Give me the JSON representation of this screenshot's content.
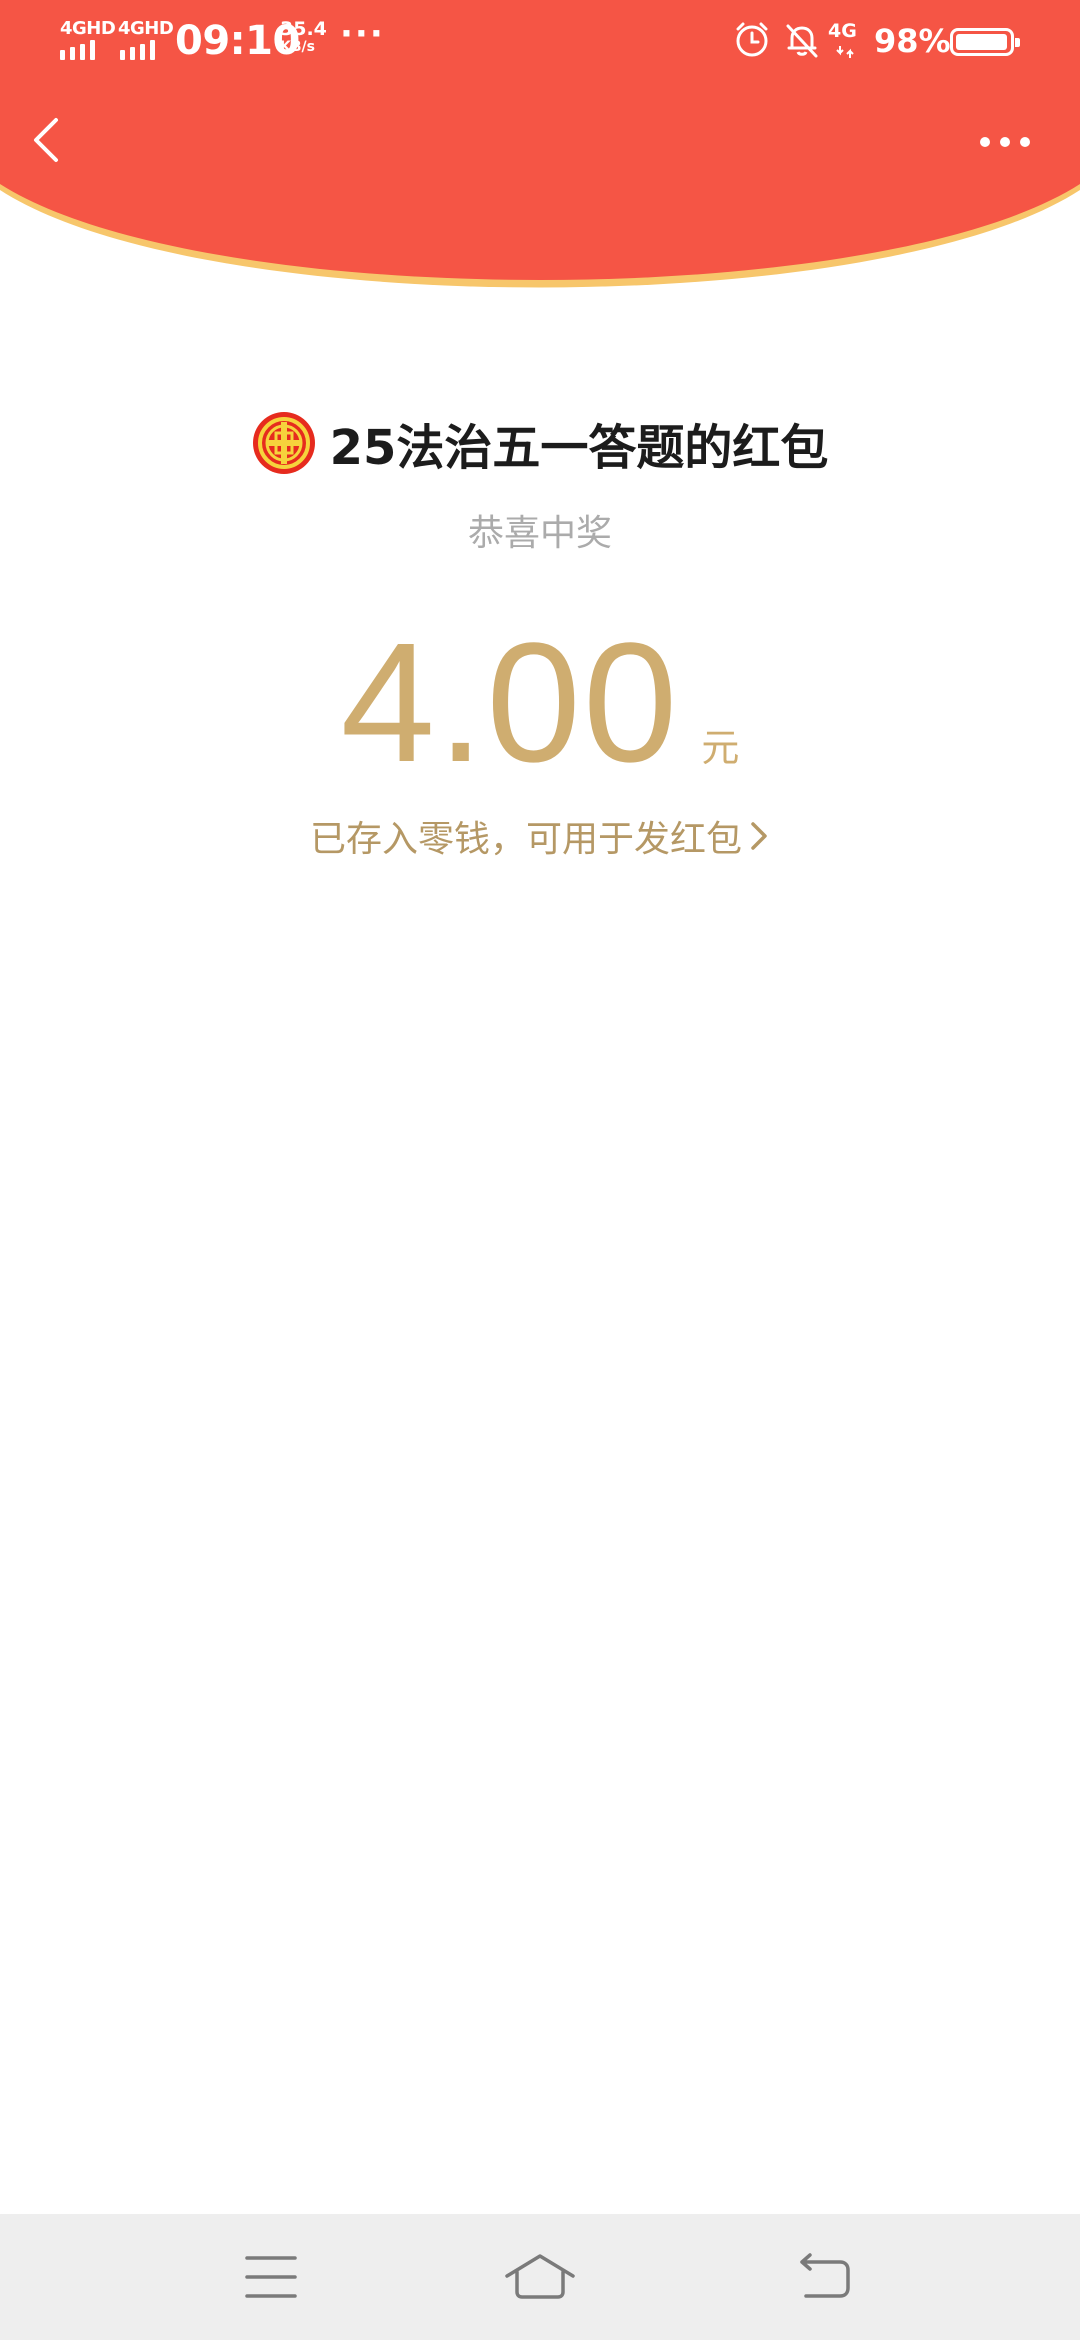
{
  "status_bar": {
    "sim1_label": "4GHD",
    "sim2_label": "4GHD",
    "time": "09:10",
    "net_speed_value": "35.4",
    "net_speed_unit": "KB/s",
    "more_indicator": "···",
    "network_type": "4G",
    "battery_percent": "98%",
    "battery_level": 0.98,
    "icons": [
      "signal-icon",
      "signal-icon",
      "alarm-icon",
      "mute-icon",
      "network-icon",
      "battery-icon"
    ]
  },
  "theme": {
    "header_red": "#f55545",
    "header_edge": "#f7c66b",
    "gold": "#cfad70",
    "gold_dark": "#b59865",
    "title_color": "#1c1c1c",
    "subtitle_color": "#ababab",
    "nav_bar_bg": "#eeeeee"
  },
  "nav": {
    "back_icon": "chevron-left-icon",
    "more_icon": "more-horizontal-icon"
  },
  "red_packet": {
    "logo_icon": "trade-union-emblem",
    "title": "25法治五一答题的红包",
    "subtitle": "恭喜中奖",
    "amount": "4.00",
    "unit": "元",
    "wallet_link_text": "已存入零钱，可用于发红包"
  },
  "bottom_nav": {
    "icons": [
      "menu-icon",
      "home-icon",
      "back-icon"
    ]
  }
}
